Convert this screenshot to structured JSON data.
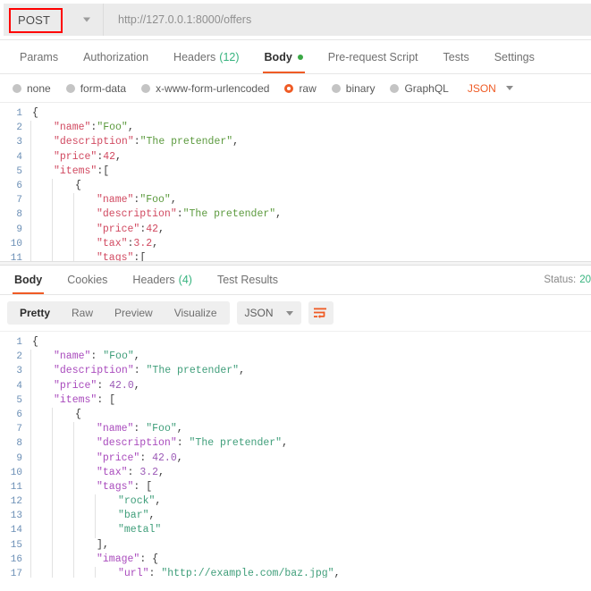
{
  "request": {
    "method": "POST",
    "method_caret_icon": "chevron-down-icon",
    "url": "http://127.0.0.1:8000/offers",
    "tabs": [
      {
        "label": "Params",
        "count": "",
        "active": false,
        "dot": false
      },
      {
        "label": "Authorization",
        "count": "",
        "active": false,
        "dot": false
      },
      {
        "label": "Headers",
        "count": "(12)",
        "active": false,
        "dot": false
      },
      {
        "label": "Body",
        "count": "",
        "active": true,
        "dot": true
      },
      {
        "label": "Pre-request Script",
        "count": "",
        "active": false,
        "dot": false
      },
      {
        "label": "Tests",
        "count": "",
        "active": false,
        "dot": false
      },
      {
        "label": "Settings",
        "count": "",
        "active": false,
        "dot": false
      }
    ],
    "body_types": [
      {
        "label": "none",
        "selected": false
      },
      {
        "label": "form-data",
        "selected": false
      },
      {
        "label": "x-www-form-urlencoded",
        "selected": false
      },
      {
        "label": "raw",
        "selected": true
      },
      {
        "label": "binary",
        "selected": false
      },
      {
        "label": "GraphQL",
        "selected": false
      }
    ],
    "format": "JSON",
    "format_caret_icon": "chevron-down-icon",
    "code_lines": [
      {
        "n": 1,
        "guides": 0,
        "tokens": [
          {
            "t": "{",
            "c": "p"
          }
        ]
      },
      {
        "n": 2,
        "guides": 1,
        "tokens": [
          {
            "t": "\"name\"",
            "c": "k"
          },
          {
            "t": ":",
            "c": "p"
          },
          {
            "t": "\"Foo\"",
            "c": "s"
          },
          {
            "t": ",",
            "c": "p"
          }
        ]
      },
      {
        "n": 3,
        "guides": 1,
        "tokens": [
          {
            "t": "\"description\"",
            "c": "k"
          },
          {
            "t": ":",
            "c": "p"
          },
          {
            "t": "\"The pretender\"",
            "c": "s"
          },
          {
            "t": ",",
            "c": "p"
          }
        ]
      },
      {
        "n": 4,
        "guides": 1,
        "tokens": [
          {
            "t": "\"price\"",
            "c": "k"
          },
          {
            "t": ":",
            "c": "p"
          },
          {
            "t": "42",
            "c": "n"
          },
          {
            "t": ",",
            "c": "p"
          }
        ]
      },
      {
        "n": 5,
        "guides": 1,
        "tokens": [
          {
            "t": "\"items\"",
            "c": "k"
          },
          {
            "t": ":[",
            "c": "p"
          }
        ]
      },
      {
        "n": 6,
        "guides": 2,
        "tokens": [
          {
            "t": "{",
            "c": "p"
          }
        ]
      },
      {
        "n": 7,
        "guides": 3,
        "tokens": [
          {
            "t": "\"name\"",
            "c": "k"
          },
          {
            "t": ":",
            "c": "p"
          },
          {
            "t": "\"Foo\"",
            "c": "s"
          },
          {
            "t": ",",
            "c": "p"
          }
        ]
      },
      {
        "n": 8,
        "guides": 3,
        "tokens": [
          {
            "t": "\"description\"",
            "c": "k"
          },
          {
            "t": ":",
            "c": "p"
          },
          {
            "t": "\"The pretender\"",
            "c": "s"
          },
          {
            "t": ",",
            "c": "p"
          }
        ]
      },
      {
        "n": 9,
        "guides": 3,
        "tokens": [
          {
            "t": "\"price\"",
            "c": "k"
          },
          {
            "t": ":",
            "c": "p"
          },
          {
            "t": "42",
            "c": "n"
          },
          {
            "t": ",",
            "c": "p"
          }
        ]
      },
      {
        "n": 10,
        "guides": 3,
        "tokens": [
          {
            "t": "\"tax\"",
            "c": "k"
          },
          {
            "t": ":",
            "c": "p"
          },
          {
            "t": "3.2",
            "c": "n"
          },
          {
            "t": ",",
            "c": "p"
          }
        ]
      },
      {
        "n": 11,
        "guides": 3,
        "tokens": [
          {
            "t": "\"tags\"",
            "c": "k"
          },
          {
            "t": ":[",
            "c": "p"
          }
        ]
      }
    ]
  },
  "response": {
    "tabs": [
      {
        "label": "Body",
        "count": "",
        "active": true
      },
      {
        "label": "Cookies",
        "count": "",
        "active": false
      },
      {
        "label": "Headers",
        "count": "(4)",
        "active": false
      },
      {
        "label": "Test Results",
        "count": "",
        "active": false
      }
    ],
    "status_label": "Status:",
    "status_value": "20",
    "view_modes": [
      {
        "label": "Pretty",
        "active": true
      },
      {
        "label": "Raw",
        "active": false
      },
      {
        "label": "Preview",
        "active": false
      },
      {
        "label": "Visualize",
        "active": false
      }
    ],
    "format": "JSON",
    "format_caret_icon": "chevron-down-icon",
    "wrap_icon": "wrap-text-icon",
    "wrap_icon_color": "#ef5b25",
    "code_lines": [
      {
        "n": 1,
        "guides": 0,
        "tokens": [
          {
            "t": "{",
            "c": "p"
          }
        ]
      },
      {
        "n": 2,
        "guides": 1,
        "tokens": [
          {
            "t": "\"name\"",
            "c": "k"
          },
          {
            "t": ": ",
            "c": "p"
          },
          {
            "t": "\"Foo\"",
            "c": "s"
          },
          {
            "t": ",",
            "c": "p"
          }
        ]
      },
      {
        "n": 3,
        "guides": 1,
        "tokens": [
          {
            "t": "\"description\"",
            "c": "k"
          },
          {
            "t": ": ",
            "c": "p"
          },
          {
            "t": "\"The pretender\"",
            "c": "s"
          },
          {
            "t": ",",
            "c": "p"
          }
        ]
      },
      {
        "n": 4,
        "guides": 1,
        "tokens": [
          {
            "t": "\"price\"",
            "c": "k"
          },
          {
            "t": ": ",
            "c": "p"
          },
          {
            "t": "42.0",
            "c": "n"
          },
          {
            "t": ",",
            "c": "p"
          }
        ]
      },
      {
        "n": 5,
        "guides": 1,
        "tokens": [
          {
            "t": "\"items\"",
            "c": "k"
          },
          {
            "t": ": [",
            "c": "p"
          }
        ]
      },
      {
        "n": 6,
        "guides": 2,
        "tokens": [
          {
            "t": "{",
            "c": "p"
          }
        ]
      },
      {
        "n": 7,
        "guides": 3,
        "tokens": [
          {
            "t": "\"name\"",
            "c": "k"
          },
          {
            "t": ": ",
            "c": "p"
          },
          {
            "t": "\"Foo\"",
            "c": "s"
          },
          {
            "t": ",",
            "c": "p"
          }
        ]
      },
      {
        "n": 8,
        "guides": 3,
        "tokens": [
          {
            "t": "\"description\"",
            "c": "k"
          },
          {
            "t": ": ",
            "c": "p"
          },
          {
            "t": "\"The pretender\"",
            "c": "s"
          },
          {
            "t": ",",
            "c": "p"
          }
        ]
      },
      {
        "n": 9,
        "guides": 3,
        "tokens": [
          {
            "t": "\"price\"",
            "c": "k"
          },
          {
            "t": ": ",
            "c": "p"
          },
          {
            "t": "42.0",
            "c": "n"
          },
          {
            "t": ",",
            "c": "p"
          }
        ]
      },
      {
        "n": 10,
        "guides": 3,
        "tokens": [
          {
            "t": "\"tax\"",
            "c": "k"
          },
          {
            "t": ": ",
            "c": "p"
          },
          {
            "t": "3.2",
            "c": "n"
          },
          {
            "t": ",",
            "c": "p"
          }
        ]
      },
      {
        "n": 11,
        "guides": 3,
        "tokens": [
          {
            "t": "\"tags\"",
            "c": "k"
          },
          {
            "t": ": [",
            "c": "p"
          }
        ]
      },
      {
        "n": 12,
        "guides": 4,
        "tokens": [
          {
            "t": "\"rock\"",
            "c": "s"
          },
          {
            "t": ",",
            "c": "p"
          }
        ]
      },
      {
        "n": 13,
        "guides": 4,
        "tokens": [
          {
            "t": "\"bar\"",
            "c": "s"
          },
          {
            "t": ",",
            "c": "p"
          }
        ]
      },
      {
        "n": 14,
        "guides": 4,
        "tokens": [
          {
            "t": "\"metal\"",
            "c": "s"
          }
        ]
      },
      {
        "n": 15,
        "guides": 3,
        "tokens": [
          {
            "t": "],",
            "c": "p"
          }
        ]
      },
      {
        "n": 16,
        "guides": 3,
        "tokens": [
          {
            "t": "\"image\"",
            "c": "k"
          },
          {
            "t": ": {",
            "c": "p"
          }
        ]
      },
      {
        "n": 17,
        "guides": 4,
        "tokens": [
          {
            "t": "\"url\"",
            "c": "k"
          },
          {
            "t": ": ",
            "c": "p"
          },
          {
            "t": "\"http://example.com/baz.jpg\"",
            "c": "s"
          },
          {
            "t": ",",
            "c": "p"
          }
        ]
      }
    ]
  },
  "colors": {
    "accent": "#ef5b25",
    "green": "#36b37e",
    "annotation_red": "#ff0000"
  }
}
